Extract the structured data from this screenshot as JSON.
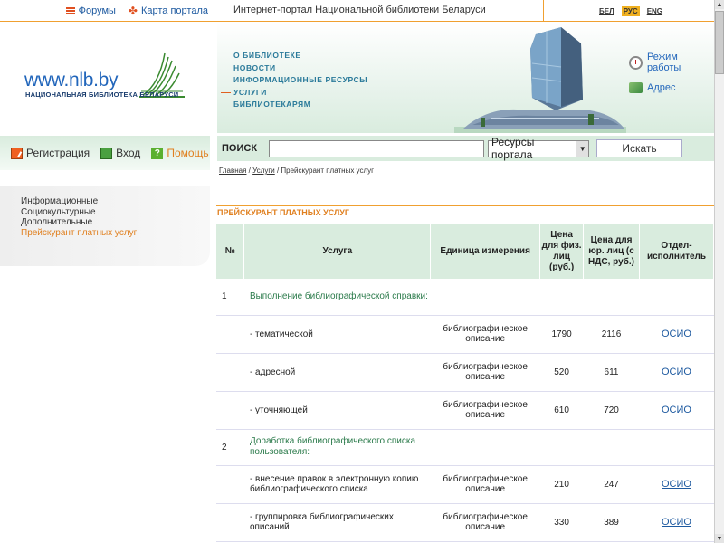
{
  "topbar": {
    "forums": "Форумы",
    "portal_map": "Карта портала",
    "title": "Интернет-портал Национальной библиотеки Беларуси",
    "langs": [
      "БЕЛ",
      "РУС",
      "ENG"
    ],
    "active_lang": "РУС"
  },
  "logo": {
    "url": "www.nlb.by",
    "subtitle": "НАЦИОНАЛЬНАЯ БИБЛИОТЕКА БЕЛАРУСИ"
  },
  "main_nav": [
    "О БИБЛИОТЕКЕ",
    "НОВОСТИ",
    "ИНФОРМАЦИОННЫЕ РЕСУРСЫ",
    "УСЛУГИ",
    "БИБЛИОТЕКАРЯМ"
  ],
  "main_nav_active": "УСЛУГИ",
  "header_links": {
    "hours": "Режим работы",
    "address": "Адрес"
  },
  "actions": {
    "register": "Регистрация",
    "login": "Вход",
    "help": "Помощь"
  },
  "search": {
    "label": "ПОИСК",
    "value": "",
    "select_value": "Ресурсы портала",
    "button": "Искать"
  },
  "breadcrumb": {
    "home": "Главная",
    "sep": " / ",
    "services": "Услуги",
    "current": "Прейскурант платных услуг"
  },
  "sidebar": [
    "Информационные",
    "Социокультурные",
    "Дополнительные",
    "Прейскурант платных услуг"
  ],
  "sidebar_active": "Прейскурант платных услуг",
  "page_title": "ПРЕЙСКУРАНТ ПЛАТНЫХ УСЛУГ",
  "table": {
    "headers": {
      "num": "№",
      "service": "Услуга",
      "unit": "Единица измерения",
      "price_phys": "Цена для физ. лиц (руб.)",
      "price_jur": "Цена для юр. лиц (с НДС, руб.)",
      "dept": "Отдел-исполнитель"
    },
    "rows": [
      {
        "num": "1",
        "service": "Выполнение библиографической справки:",
        "unit": "",
        "price_phys": "",
        "price_jur": "",
        "dept": "",
        "group": true
      },
      {
        "num": "",
        "service": "- тематической",
        "unit": "библиографическое описание",
        "price_phys": "1790",
        "price_jur": "2116",
        "dept": "ОСИО",
        "group": false
      },
      {
        "num": "",
        "service": "- адресной",
        "unit": "библиографическое описание",
        "price_phys": "520",
        "price_jur": "611",
        "dept": "ОСИО",
        "group": false
      },
      {
        "num": "",
        "service": "- уточняющей",
        "unit": "библиографическое описание",
        "price_phys": "610",
        "price_jur": "720",
        "dept": "ОСИО",
        "group": false
      },
      {
        "num": "2",
        "service": "Доработка библиографического списка пользователя:",
        "unit": "",
        "price_phys": "",
        "price_jur": "",
        "dept": "",
        "group": true
      },
      {
        "num": "",
        "service": "- внесение правок в электронную копию библиографического списка",
        "unit": "библиографическое описание",
        "price_phys": "210",
        "price_jur": "247",
        "dept": "ОСИО",
        "group": false
      },
      {
        "num": "",
        "service": "- группировка библиографических описаний",
        "unit": "библиографическое описание",
        "price_phys": "330",
        "price_jur": "389",
        "dept": "ОСИО",
        "group": false
      }
    ]
  },
  "colors": {
    "accent_orange": "#e08020",
    "link_blue": "#1e5aa0",
    "header_green": "#d9ecde"
  }
}
